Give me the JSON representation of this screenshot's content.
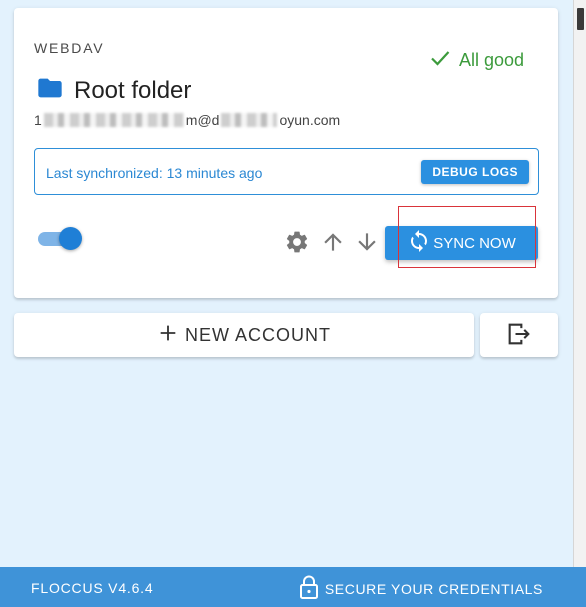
{
  "account": {
    "type": "WEBDAV",
    "status": "All good",
    "folder_title": "Root folder",
    "email_prefix": "1",
    "email_suffix": "m@d",
    "email_domain": "oyun.com",
    "last_sync": "Last synchronized: 13 minutes ago",
    "debug_logs_label": "DEBUG LOGS",
    "sync_now_label": "SYNC NOW",
    "enabled": true
  },
  "actions": {
    "new_account_label": "NEW ACCOUNT"
  },
  "footer": {
    "version": "FLOCCUS V4.6.4",
    "secure_label": "SECURE YOUR CREDENTIALS"
  },
  "icons": {
    "status": "check-icon",
    "folder": "folder-icon",
    "settings": "gear-icon",
    "upload": "arrow-up-icon",
    "download": "arrow-down-icon",
    "sync": "sync-icon",
    "add": "plus-icon",
    "logout": "logout-icon",
    "lock": "lock-icon"
  },
  "colors": {
    "background": "#e3f2fd",
    "primary": "#2b90e0",
    "success": "#3c9b3c",
    "footer": "#3f93d8",
    "highlight": "#d9343a"
  }
}
